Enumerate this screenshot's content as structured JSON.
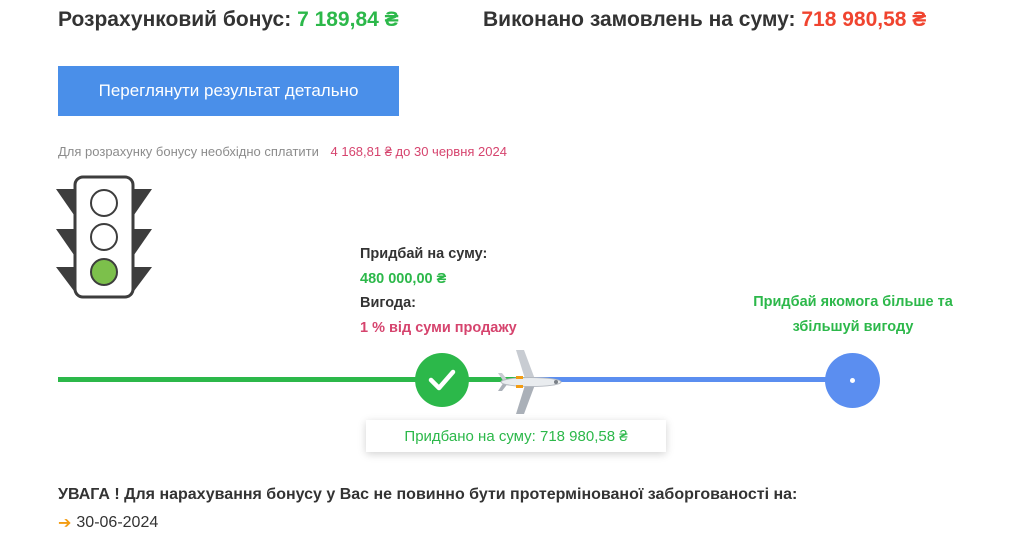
{
  "header": {
    "bonus_label": "Розрахунковий бонус:",
    "bonus_value": "7 189,84 ₴",
    "orders_label": "Виконано замовлень на суму:",
    "orders_value": "718 980,58 ₴"
  },
  "detail_button": {
    "label": "Переглянути результат детально"
  },
  "payment_note": {
    "text": "Для розрахунку бонусу необхідно сплатити",
    "amount": "4 168,81 ₴ до 30 червня 2024"
  },
  "traffic_light": {
    "active_lamp": "green",
    "icon": "traffic-light-icon"
  },
  "tier": {
    "buy_label": "Придбай на суму:",
    "buy_value": "480 000,00 ₴",
    "benefit_label": "Вигода:",
    "benefit_value": "1 % від суми продажу"
  },
  "next_tier": {
    "line1": "Придбай якомога більше та",
    "line2": "збільшуй вигоду"
  },
  "progress": {
    "purchased_label": "Придбано на суму: 718 980,58 ₴",
    "completed_node_icon": "check-icon",
    "marker_icon": "airplane-icon"
  },
  "warning": {
    "text": "УВАГА ! Для нарахування бонусу у Вас не повинно бути протермінованої заборгованості на:",
    "date": "30-06-2024",
    "icon": "arrow-right-icon"
  },
  "colors": {
    "green": "#2cb84a",
    "red": "#f0442f",
    "blue": "#5b8ef0",
    "button": "#4a8fe9",
    "pink": "#d6446e"
  }
}
